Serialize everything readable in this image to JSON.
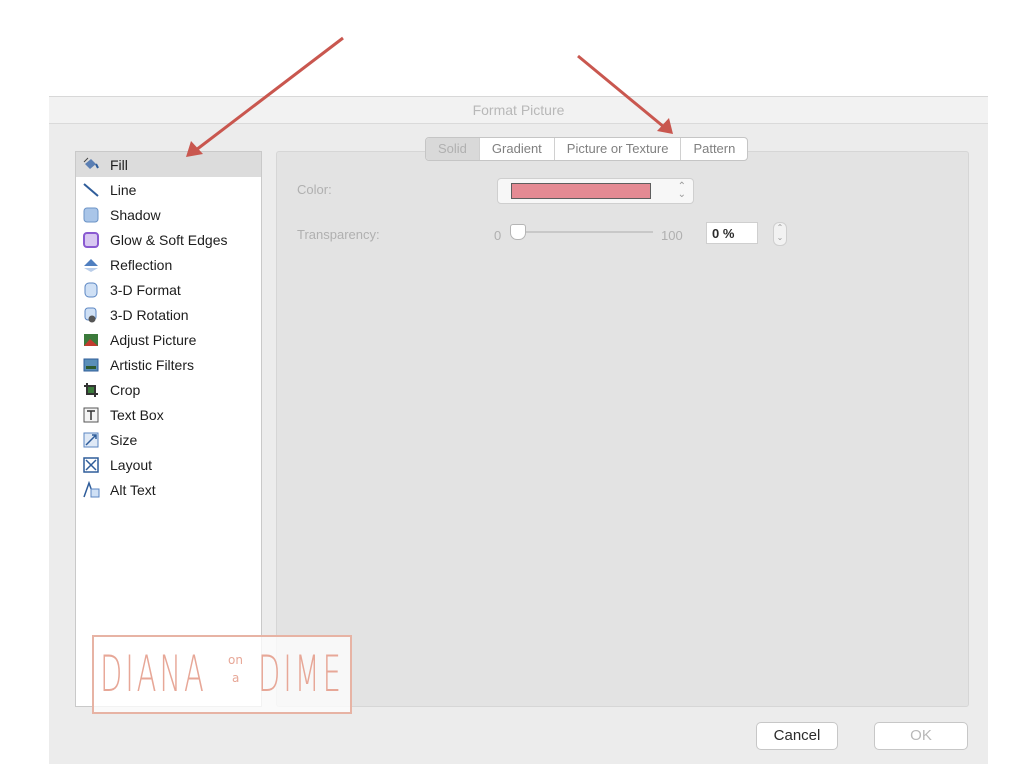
{
  "window": {
    "title": "Format Picture"
  },
  "sidebar": {
    "items": [
      {
        "label": "Fill",
        "icon": "fill-bucket-icon",
        "selected": true
      },
      {
        "label": "Line",
        "icon": "line-icon"
      },
      {
        "label": "Shadow",
        "icon": "shadow-icon"
      },
      {
        "label": "Glow & Soft Edges",
        "icon": "glow-icon"
      },
      {
        "label": "Reflection",
        "icon": "reflection-icon"
      },
      {
        "label": "3-D Format",
        "icon": "3d-format-icon"
      },
      {
        "label": "3-D Rotation",
        "icon": "3d-rotation-icon"
      },
      {
        "label": "Adjust Picture",
        "icon": "adjust-picture-icon"
      },
      {
        "label": "Artistic Filters",
        "icon": "artistic-filters-icon"
      },
      {
        "label": "Crop",
        "icon": "crop-icon"
      },
      {
        "label": "Text Box",
        "icon": "text-box-icon"
      },
      {
        "label": "Size",
        "icon": "size-icon"
      },
      {
        "label": "Layout",
        "icon": "layout-icon"
      },
      {
        "label": "Alt Text",
        "icon": "alt-text-icon"
      }
    ]
  },
  "tabs": [
    {
      "label": "Solid",
      "active": true
    },
    {
      "label": "Gradient"
    },
    {
      "label": "Picture or Texture"
    },
    {
      "label": "Pattern"
    }
  ],
  "fill": {
    "color_label": "Color:",
    "color_value": "#e48a93",
    "transparency_label": "Transparency:",
    "slider_min": "0",
    "slider_max": "100",
    "transparency_value": "0 %",
    "transparency_fraction": 0
  },
  "buttons": {
    "cancel": "Cancel",
    "ok": "OK"
  },
  "watermark": {
    "left": "DIANA",
    "on": "on",
    "a": "a",
    "right": "DIME"
  },
  "colors": {
    "arrow": "#c9574f",
    "watermark": "#e7a797",
    "selected_row": "#dcdcdc"
  }
}
